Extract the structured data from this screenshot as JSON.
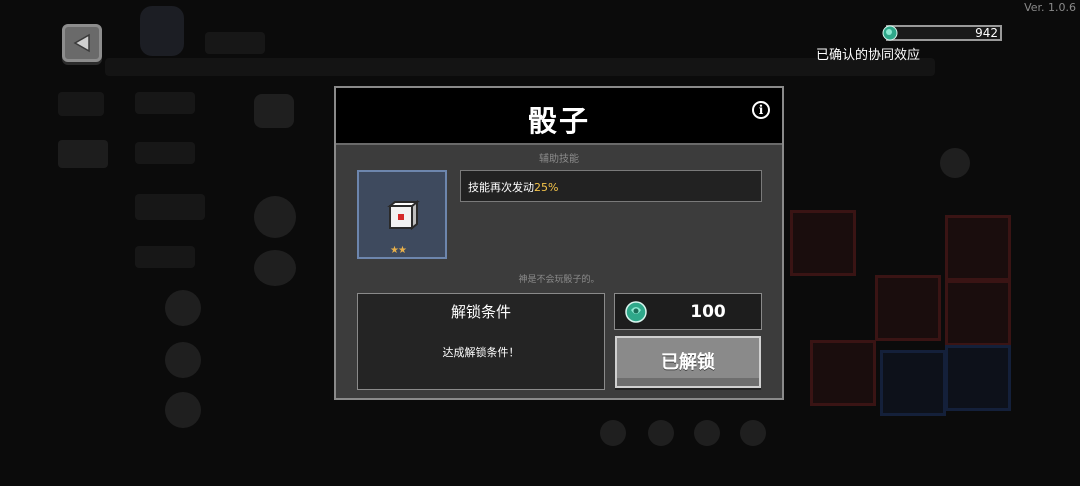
{
  "version": "Ver. 1.0.6",
  "currency": {
    "value": "942",
    "icon": "gem-icon"
  },
  "synergy_label": "已确认的协同效应",
  "dialog": {
    "title": "骰子",
    "category": "辅助技能",
    "skill_text": "技能再次发动",
    "skill_value": "25%",
    "flavor_text": "神是不会玩骰子的。",
    "unlock_title": "解锁条件",
    "unlock_desc": "达成解锁条件！",
    "cost": "100",
    "unlocked_label": "已解锁",
    "stars": "★★"
  },
  "colors": {
    "accent_value": "#f5c54a",
    "slot_bg": "#3e4a5e",
    "gem": "#2fa88a"
  }
}
